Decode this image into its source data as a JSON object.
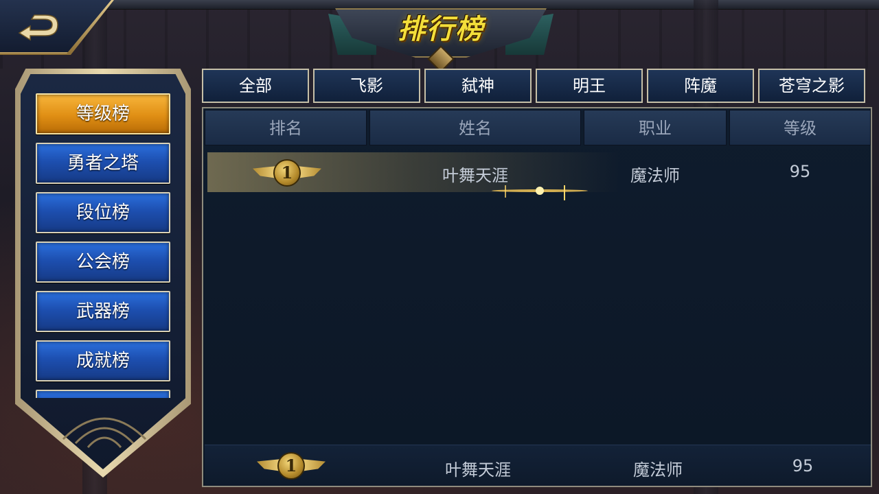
{
  "title": "排行榜",
  "categories": [
    {
      "label": "等级榜",
      "active": true
    },
    {
      "label": "勇者之塔",
      "active": false
    },
    {
      "label": "段位榜",
      "active": false
    },
    {
      "label": "公会榜",
      "active": false
    },
    {
      "label": "武器榜",
      "active": false
    },
    {
      "label": "成就榜",
      "active": false
    }
  ],
  "tabs": [
    "全部",
    "飞影",
    "弑神",
    "明王",
    "阵魔",
    "苍穹之影"
  ],
  "table": {
    "headers": [
      "排名",
      "姓名",
      "职业",
      "等级"
    ],
    "rows": [
      {
        "rank": "1",
        "name": "叶舞天涯",
        "class": "魔法师",
        "level": "95"
      }
    ]
  },
  "my_rank": {
    "rank": "1",
    "name": "叶舞天涯",
    "class": "魔法师",
    "level": "95"
  },
  "colors": {
    "accent_gold": "#f4de3a",
    "active_tab": "#e08f14",
    "button_blue": "#1d4fb0"
  },
  "icons": {
    "back": "back-arrow-icon",
    "medal": "rank-medal-icon"
  }
}
